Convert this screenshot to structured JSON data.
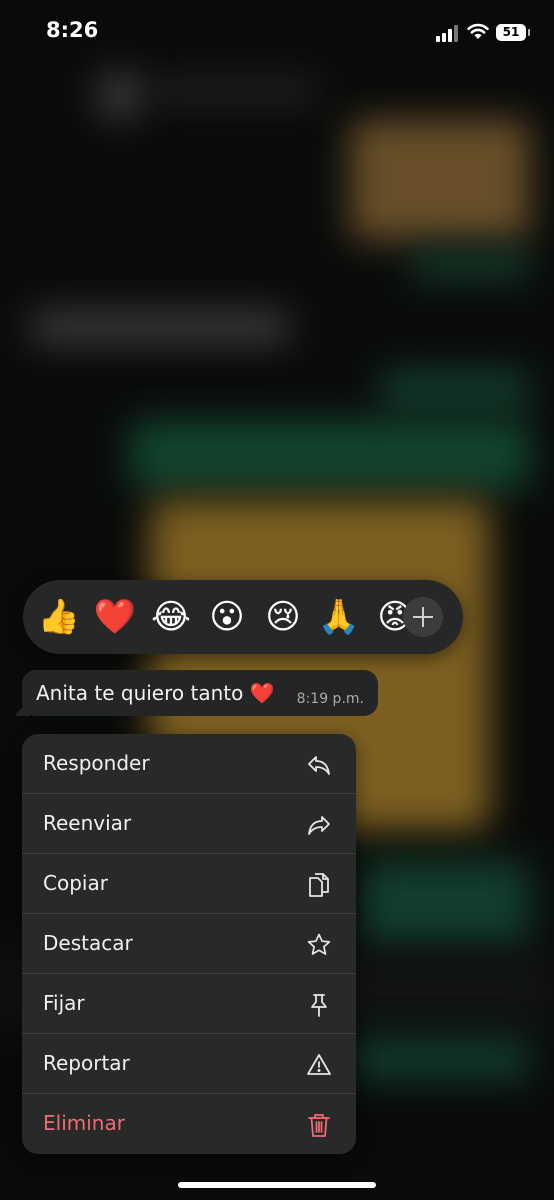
{
  "status_bar": {
    "time": "8:26",
    "battery": "51"
  },
  "reactions": {
    "emojis": [
      "👍",
      "❤️",
      "😂",
      "😮",
      "😢",
      "🙏",
      "😡"
    ],
    "more_icon": "plus-icon"
  },
  "message": {
    "text": "Anita te quiero tanto ❤️",
    "time": "8:19 p.m."
  },
  "menu": {
    "items": [
      {
        "label": "Responder",
        "icon": "reply-icon"
      },
      {
        "label": "Reenviar",
        "icon": "forward-icon"
      },
      {
        "label": "Copiar",
        "icon": "copy-icon"
      },
      {
        "label": "Destacar",
        "icon": "star-icon"
      },
      {
        "label": "Fijar",
        "icon": "pin-icon"
      },
      {
        "label": "Reportar",
        "icon": "warning-icon"
      },
      {
        "label": "Eliminar",
        "icon": "trash-icon"
      }
    ],
    "danger_color": "#ef6b73"
  }
}
